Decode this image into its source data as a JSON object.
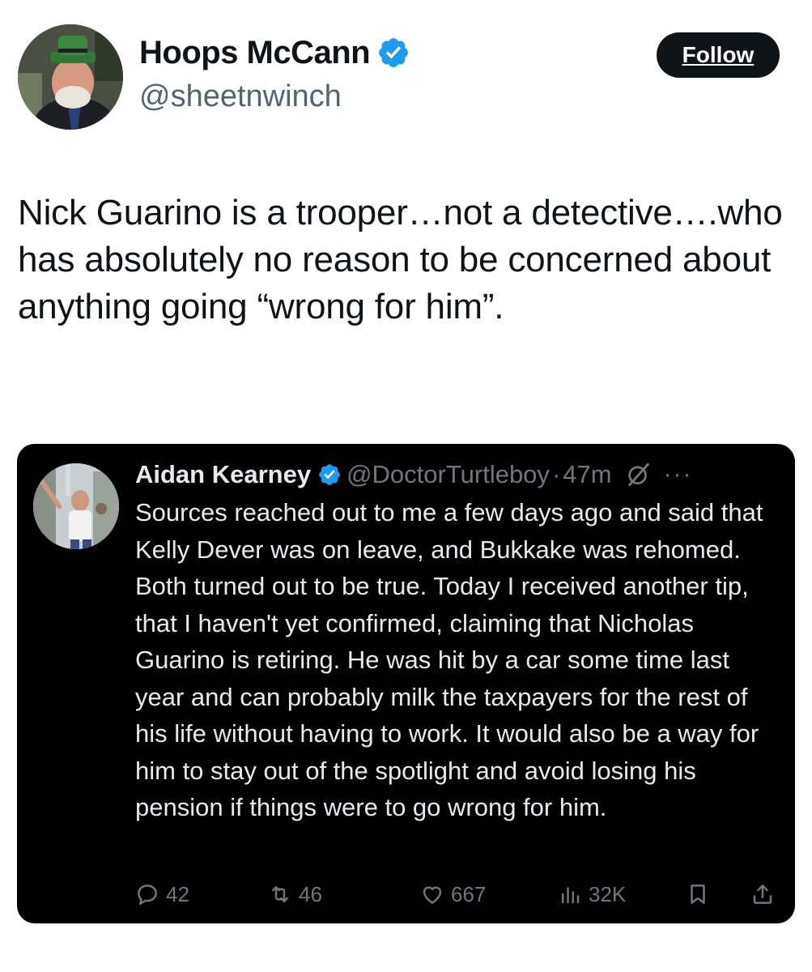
{
  "author": {
    "name": "Hoops McCann",
    "handle": "@sheetnwinch",
    "verified_color": "#1d9bf0"
  },
  "follow_label": "Follow",
  "tweet_text": "Nick Guarino is a trooper…not a detective….who has absolutely no reason to be concerned about anything going “wrong for him”.",
  "quoted": {
    "name": "Aidan Kearney",
    "handle": "@DoctorTurtleboy",
    "separator": "·",
    "time": "47m",
    "more_label": "···",
    "text": "Sources reached out to me a few days ago and said that Kelly Dever was on leave, and Bukkake was rehomed. Both turned out to be true. Today I received another tip, that I haven't yet confirmed, claiming that Nicholas Guarino is retiring. He was hit by a car some time last year and can probably milk the taxpayers for the rest of his life without having to work. It would also be a way for him to stay out of the spotlight and avoid losing his pension if things were to go wrong for him.",
    "replies": "42",
    "reposts": "46",
    "likes": "667",
    "views": "32K",
    "icons": [
      "reply-icon",
      "repost-icon",
      "like-icon",
      "views-icon",
      "bookmark-icon",
      "share-icon"
    ]
  },
  "colors": {
    "text": "#0f1419",
    "secondary": "#536471",
    "card_bg": "#000000",
    "card_text": "#e7e9ea",
    "card_secondary": "#71767b",
    "brand_blue": "#1d9bf0"
  }
}
